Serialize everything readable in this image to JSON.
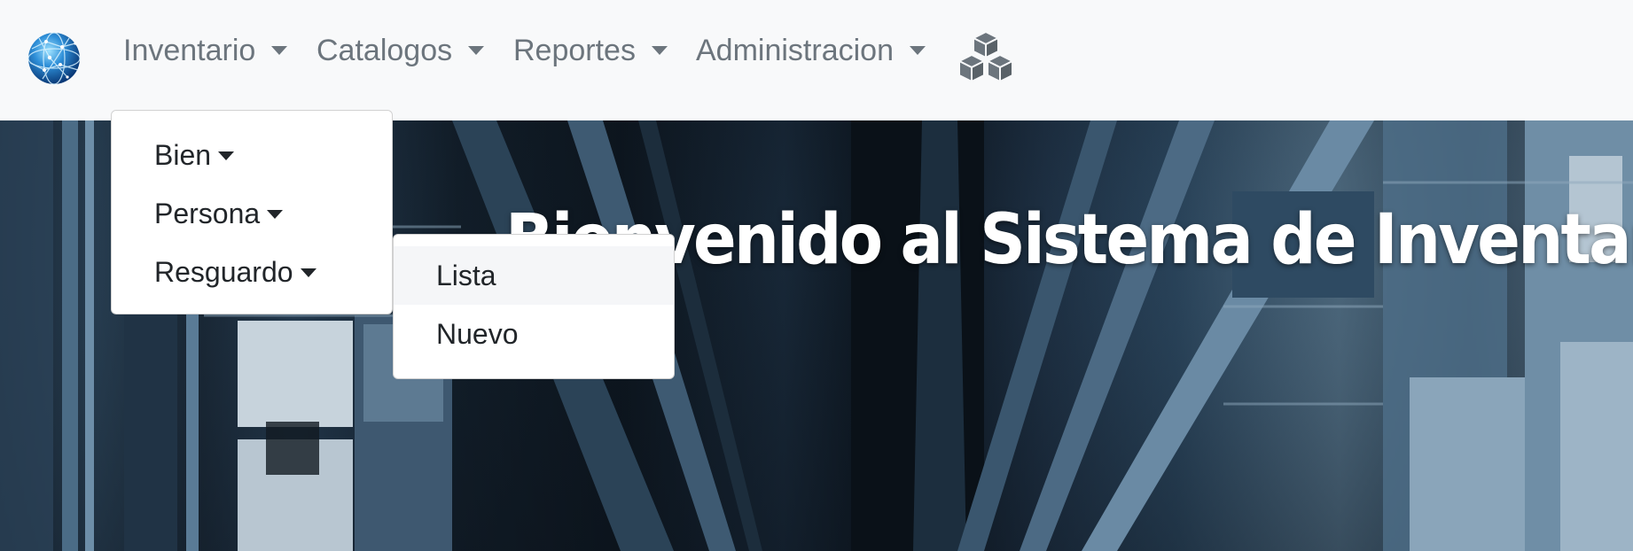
{
  "navbar": {
    "logo_icon": "globe-logo-icon",
    "items": [
      {
        "label": "Inventario"
      },
      {
        "label": "Catalogos"
      },
      {
        "label": "Reportes"
      },
      {
        "label": "Administracion"
      }
    ],
    "cubes_icon": "cubes-icon"
  },
  "hero": {
    "title": "Bienvenido al Sistema de Inventarios"
  },
  "inventario_menu": {
    "items": [
      {
        "label": "Bien"
      },
      {
        "label": "Persona"
      },
      {
        "label": "Resguardo"
      }
    ]
  },
  "resguardo_submenu": {
    "items": [
      {
        "label": "Lista",
        "highlighted": true
      },
      {
        "label": "Nuevo"
      }
    ]
  },
  "colors": {
    "navbar_bg": "#f8f9fa",
    "nav_text": "#6c757d",
    "menu_text": "#212529",
    "hero_text": "#ffffff"
  }
}
